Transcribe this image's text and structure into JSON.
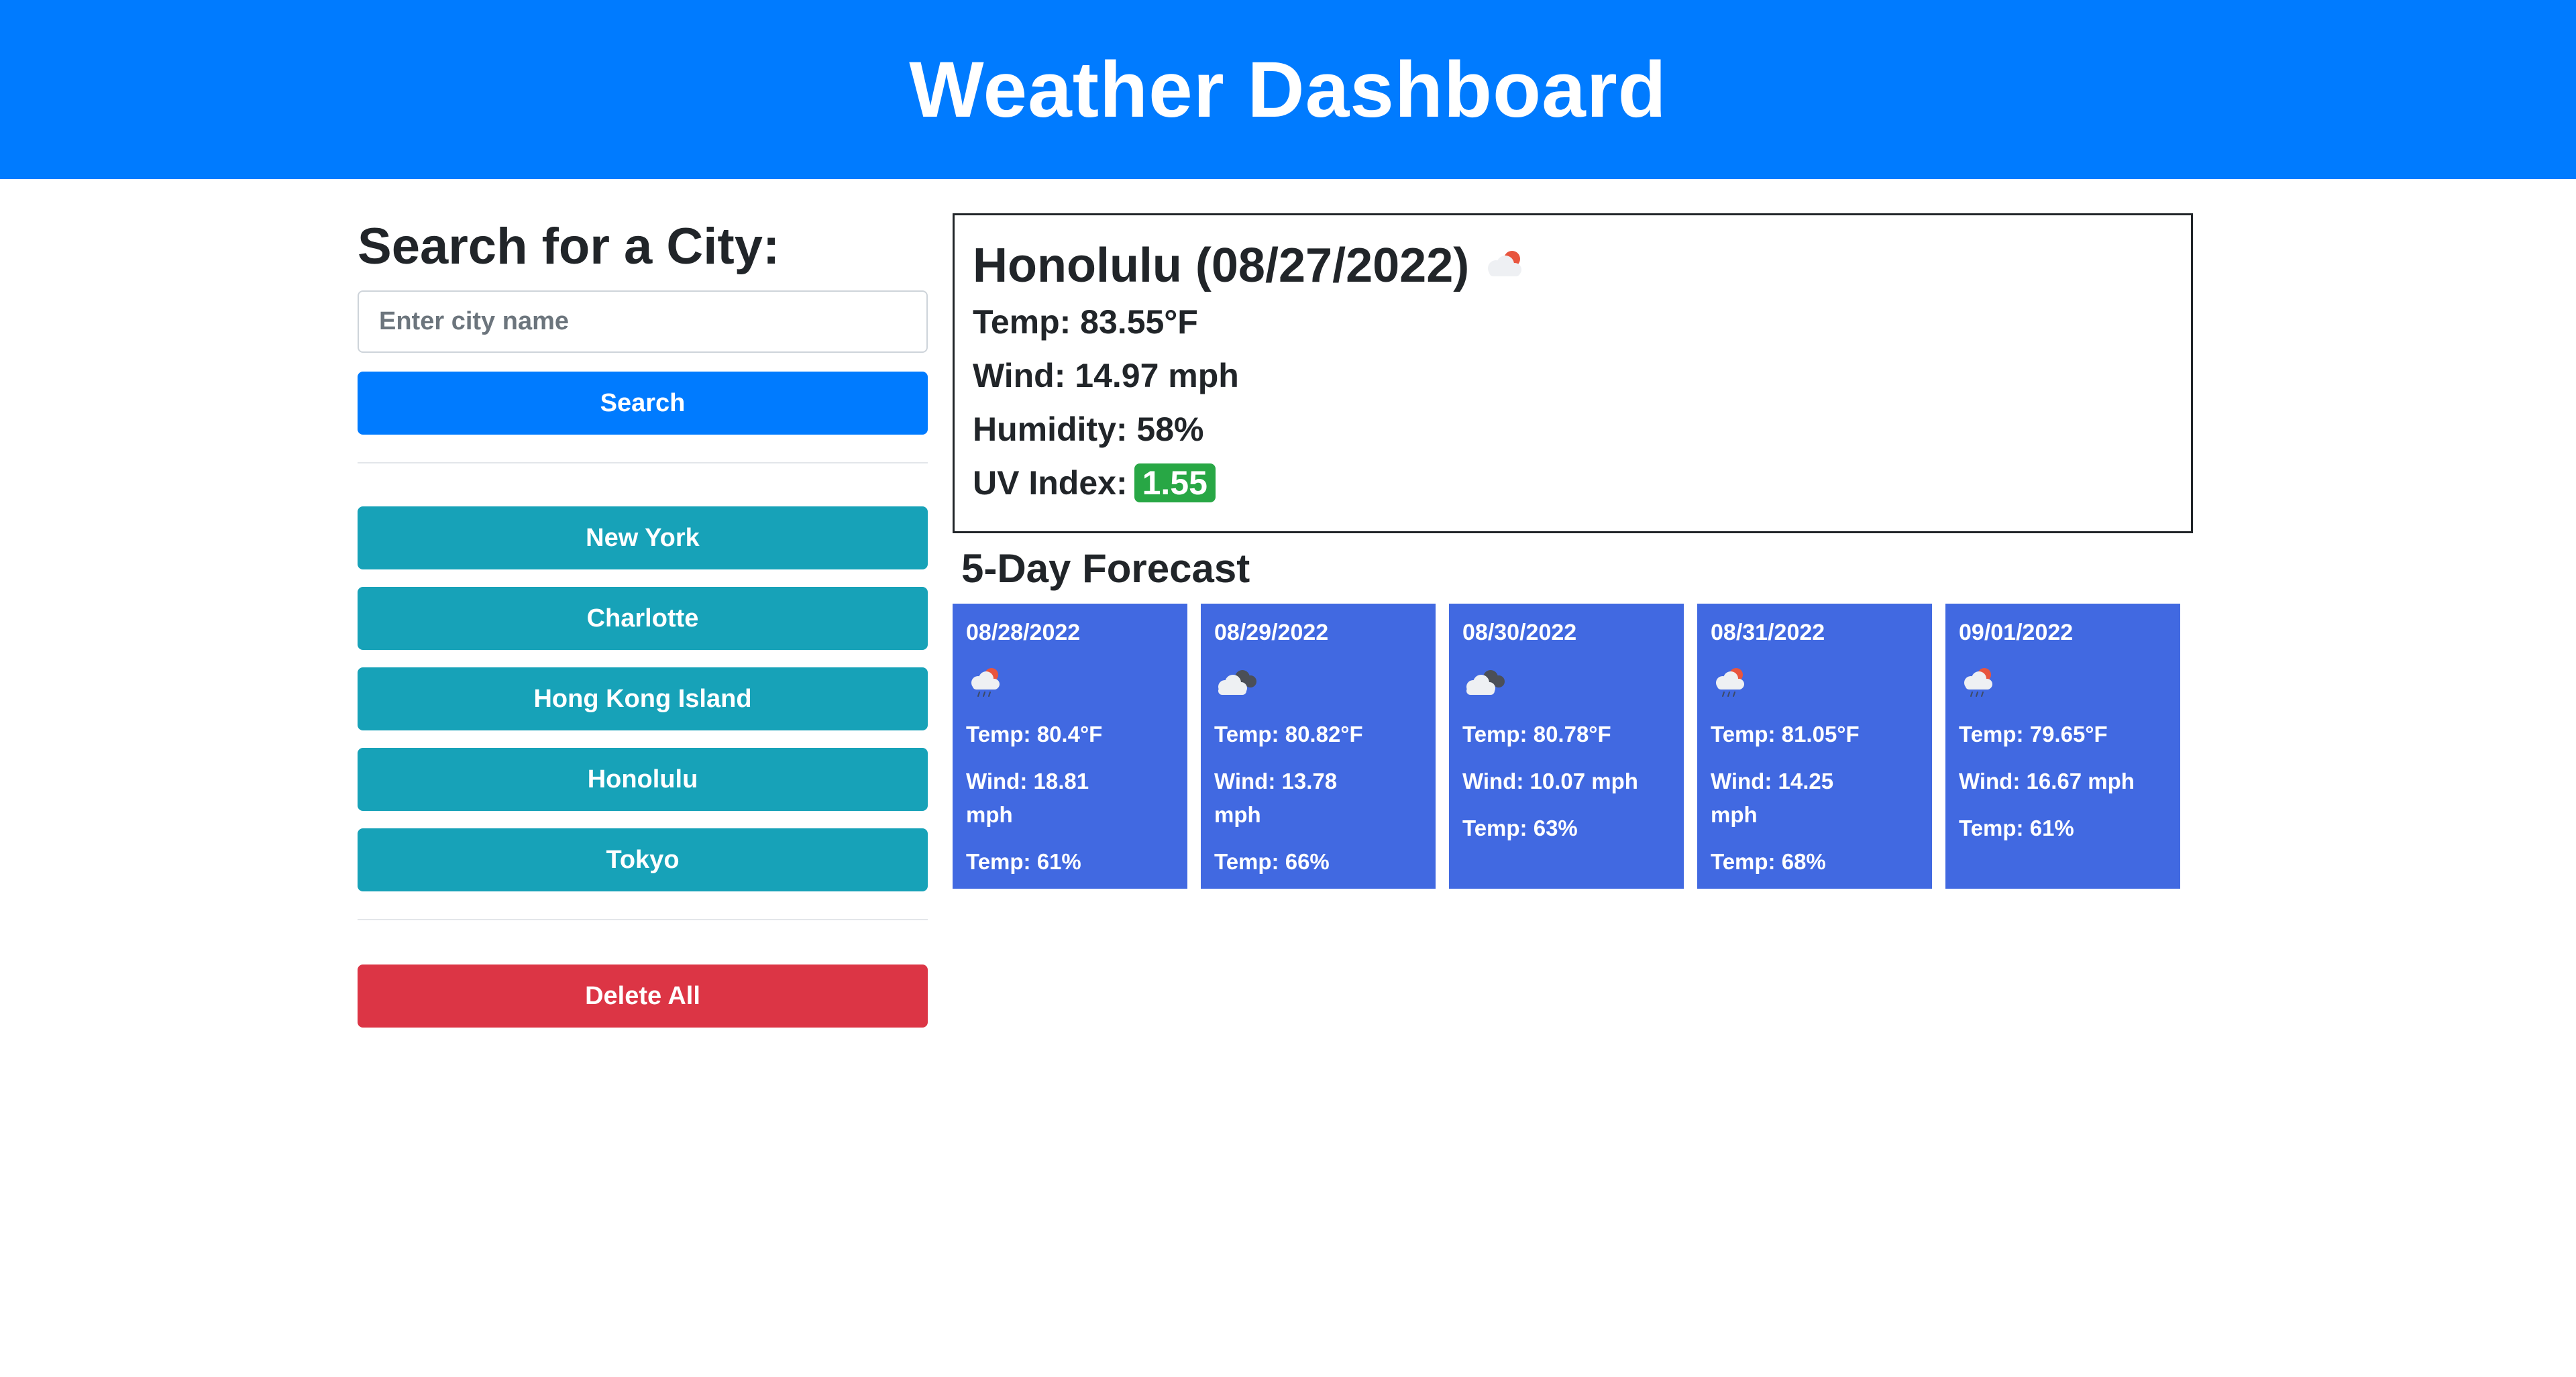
{
  "header": {
    "title": "Weather Dashboard"
  },
  "search": {
    "heading": "Search for a City:",
    "placeholder": "Enter city name",
    "value": "",
    "button_label": "Search"
  },
  "history": [
    {
      "label": "New York"
    },
    {
      "label": "Charlotte"
    },
    {
      "label": "Hong Kong Island"
    },
    {
      "label": "Honolulu"
    },
    {
      "label": "Tokyo"
    }
  ],
  "delete_button_label": "Delete All",
  "current": {
    "city_date": "Honolulu (08/27/2022)",
    "icon": "cloud-sun-icon",
    "temp": "Temp: 83.55°F",
    "wind": "Wind: 14.97 mph",
    "humidity_label": "Humidity: 58%",
    "uv_label": "UV Index:",
    "uv_value": "1.55",
    "uv_color": "#28a745"
  },
  "forecast": {
    "title": "5-Day Forecast",
    "card_color": "#4169e1",
    "days": [
      {
        "date": "08/28/2022",
        "icon": "cloud-sun-rain-icon",
        "temp": "Temp: 80.4°F",
        "wind": "Wind: 18.81 mph",
        "humidity": "Temp: 61%"
      },
      {
        "date": "08/29/2022",
        "icon": "cloud-dark-icon",
        "temp": "Temp: 80.82°F",
        "wind": "Wind: 13.78 mph",
        "humidity": "Temp: 66%"
      },
      {
        "date": "08/30/2022",
        "icon": "cloud-dark-icon",
        "temp": "Temp: 80.78°F",
        "wind": "Wind: 10.07 mph",
        "humidity": "Temp: 63%"
      },
      {
        "date": "08/31/2022",
        "icon": "cloud-sun-rain-icon",
        "temp": "Temp: 81.05°F",
        "wind": "Wind: 14.25 mph",
        "humidity": "Temp: 68%"
      },
      {
        "date": "09/01/2022",
        "icon": "cloud-sun-rain-icon",
        "temp": "Temp: 79.65°F",
        "wind": "Wind: 16.67 mph",
        "humidity": "Temp: 61%"
      }
    ]
  },
  "colors": {
    "primary": "#007bff",
    "info": "#17a2b8",
    "danger": "#dc3545"
  }
}
